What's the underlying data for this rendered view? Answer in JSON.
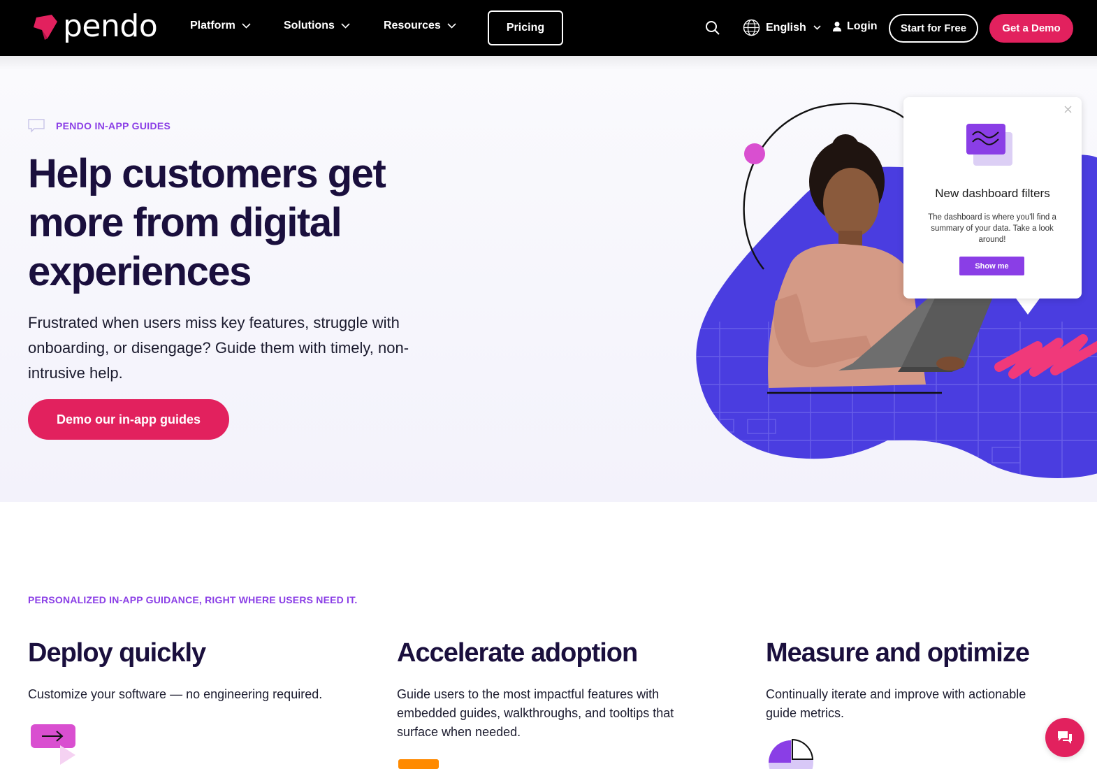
{
  "colors": {
    "brand_pink": "#e2215e",
    "brand_purple": "#8a3ee6",
    "blob_blue": "#4a3de0",
    "title_navy": "#1a0f3d"
  },
  "nav": {
    "logo_text": "pendo",
    "items": [
      {
        "label": "Platform",
        "icon": "chevron-down-icon"
      },
      {
        "label": "Solutions",
        "icon": "chevron-down-icon"
      },
      {
        "label": "Resources",
        "icon": "chevron-down-icon"
      }
    ],
    "pricing_label": "Pricing",
    "search_icon": "search-icon",
    "language_label": "English",
    "login_label": "Login",
    "start_free_label": "Start for Free",
    "get_demo_label": "Get a Demo"
  },
  "hero": {
    "eyebrow": "PENDO IN-APP GUIDES",
    "title": "Help customers get more from digital experiences",
    "description": "Frustrated when users miss key features, struggle with onboarding, or disengage? Guide them with timely, non-intrusive help.",
    "cta_label": "Demo our in-app guides",
    "guide_card": {
      "title": "New dashboard filters",
      "text": "The dashboard is where you'll find a summary of your data. Take a look around!",
      "button_label": "Show me"
    }
  },
  "features": {
    "eyebrow": "PERSONALIZED IN-APP GUIDANCE, RIGHT WHERE USERS NEED IT.",
    "columns": [
      {
        "title": "Deploy quickly",
        "description": "Customize your software — no engineering required.",
        "icon": "arrow-button-icon"
      },
      {
        "title": "Accelerate adoption",
        "description": "Guide users to the most impactful features with embedded guides, walkthroughs, and tooltips that surface when needed.",
        "icon": "orange-tile-icon"
      },
      {
        "title": "Measure and optimize",
        "description": "Continually iterate and improve with actionable guide metrics.",
        "icon": "pie-chart-icon"
      }
    ]
  },
  "chat_icon": "chat-bubble-icon"
}
